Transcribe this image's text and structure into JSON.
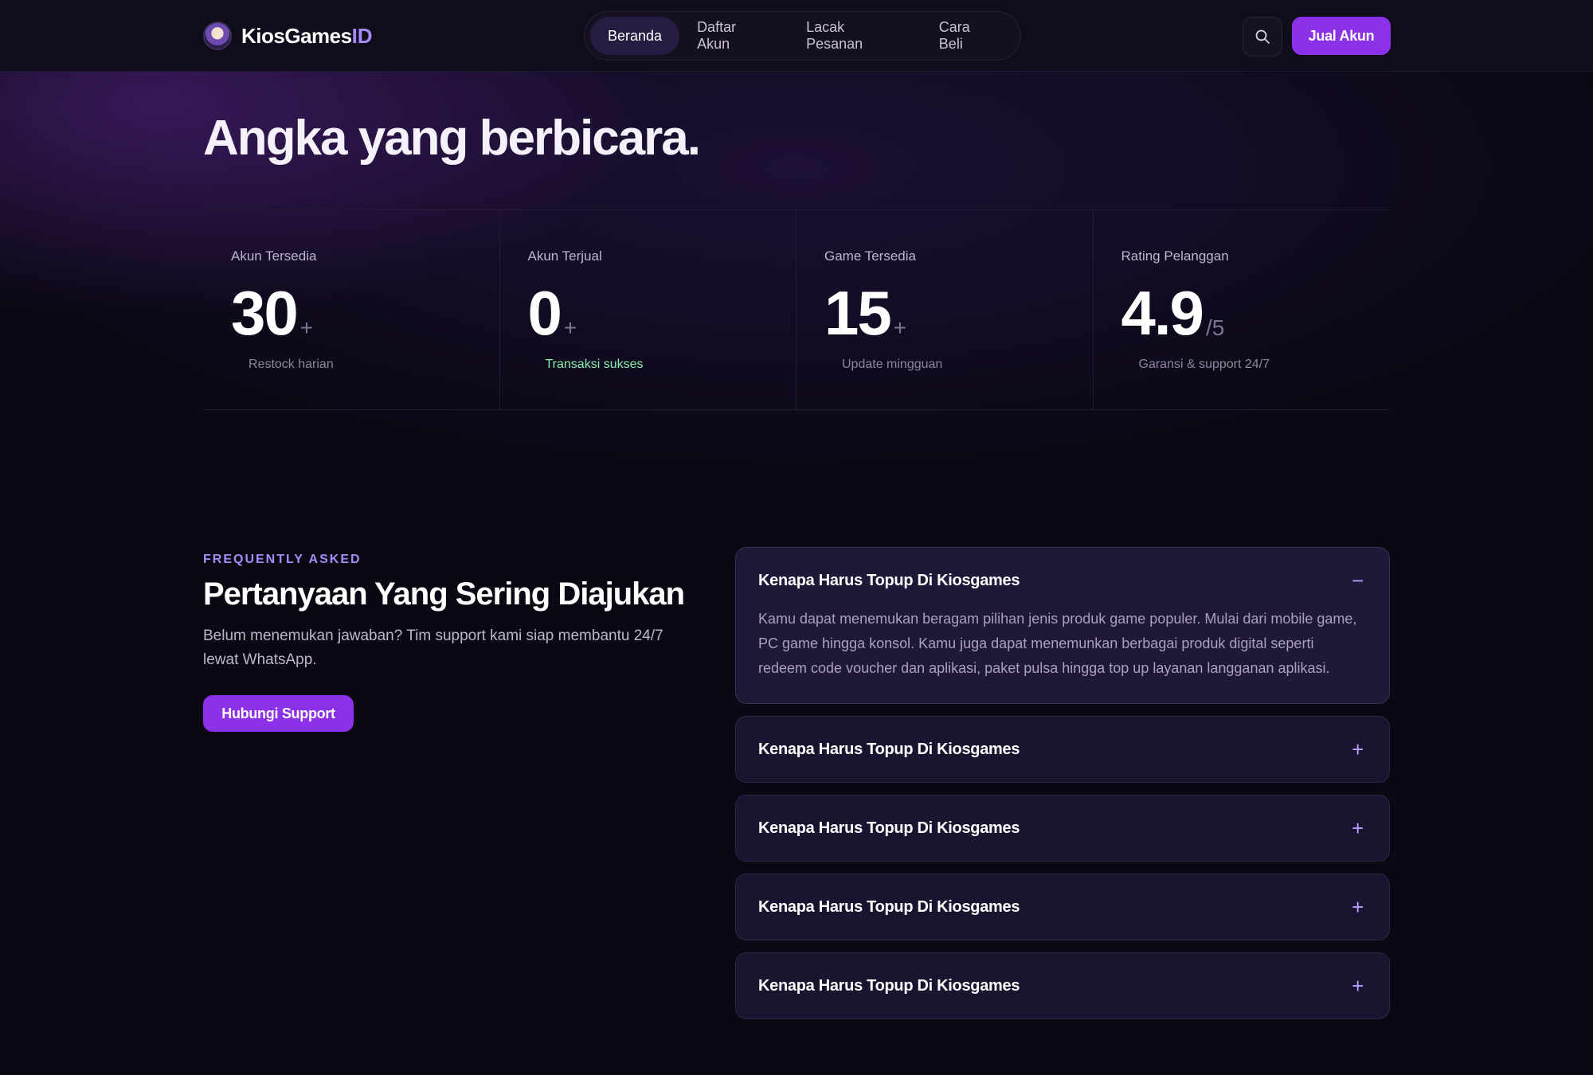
{
  "header": {
    "logo_text": "KiosGames",
    "logo_accent": "ID",
    "nav": [
      {
        "label": "Beranda",
        "active": true
      },
      {
        "label": "Daftar Akun",
        "active": false
      },
      {
        "label": "Lacak Pesanan",
        "active": false
      },
      {
        "label": "Cara Beli",
        "active": false
      }
    ],
    "search_icon": "search-icon",
    "sell_label": "Jual Akun"
  },
  "hero": {
    "title": "Angka yang berbicara."
  },
  "stats": [
    {
      "label": "Akun Tersedia",
      "value": "30",
      "suffix": "+",
      "note": "Restock harian",
      "note_color": "#8c859e"
    },
    {
      "label": "Akun Terjual",
      "value": "0",
      "suffix": "+",
      "note": "Transaksi sukses",
      "note_color": "#86efac"
    },
    {
      "label": "Game Tersedia",
      "value": "15",
      "suffix": "+",
      "note": "Update mingguan",
      "note_color": "#8c859e"
    },
    {
      "label": "Rating Pelanggan",
      "value": "4.9",
      "suffix": "/5",
      "note": "Garansi & support 24/7",
      "note_color": "#8c859e"
    }
  ],
  "faq": {
    "eyebrow": "FREQUENTLY ASKED",
    "title": "Pertanyaan Yang Sering Diajukan",
    "description": "Belum menemukan jawaban? Tim support kami siap membantu 24/7 lewat WhatsApp.",
    "support_label": "Hubungi Support",
    "items": [
      {
        "question": "Kenapa Harus Topup Di Kiosgames",
        "toggle": "−",
        "open": true,
        "answer": "Kamu dapat menemukan beragam pilihan jenis produk game populer. Mulai dari mobile game, PC game hingga konsol. Kamu juga dapat menemunkan berbagai produk digital seperti redeem code voucher dan aplikasi, paket pulsa hingga top up layanan langganan aplikasi."
      },
      {
        "question": "Kenapa Harus Topup Di Kiosgames",
        "toggle": "+",
        "open": false
      },
      {
        "question": "Kenapa Harus Topup Di Kiosgames",
        "toggle": "+",
        "open": false
      },
      {
        "question": "Kenapa Harus Topup Di Kiosgames",
        "toggle": "+",
        "open": false
      },
      {
        "question": "Kenapa Harus Topup Di Kiosgames",
        "toggle": "+",
        "open": false
      }
    ]
  },
  "colors": {
    "accent": "#8b31e8",
    "accent_light": "#a78bfa",
    "background": "#0b0814",
    "success": "#86efac"
  }
}
